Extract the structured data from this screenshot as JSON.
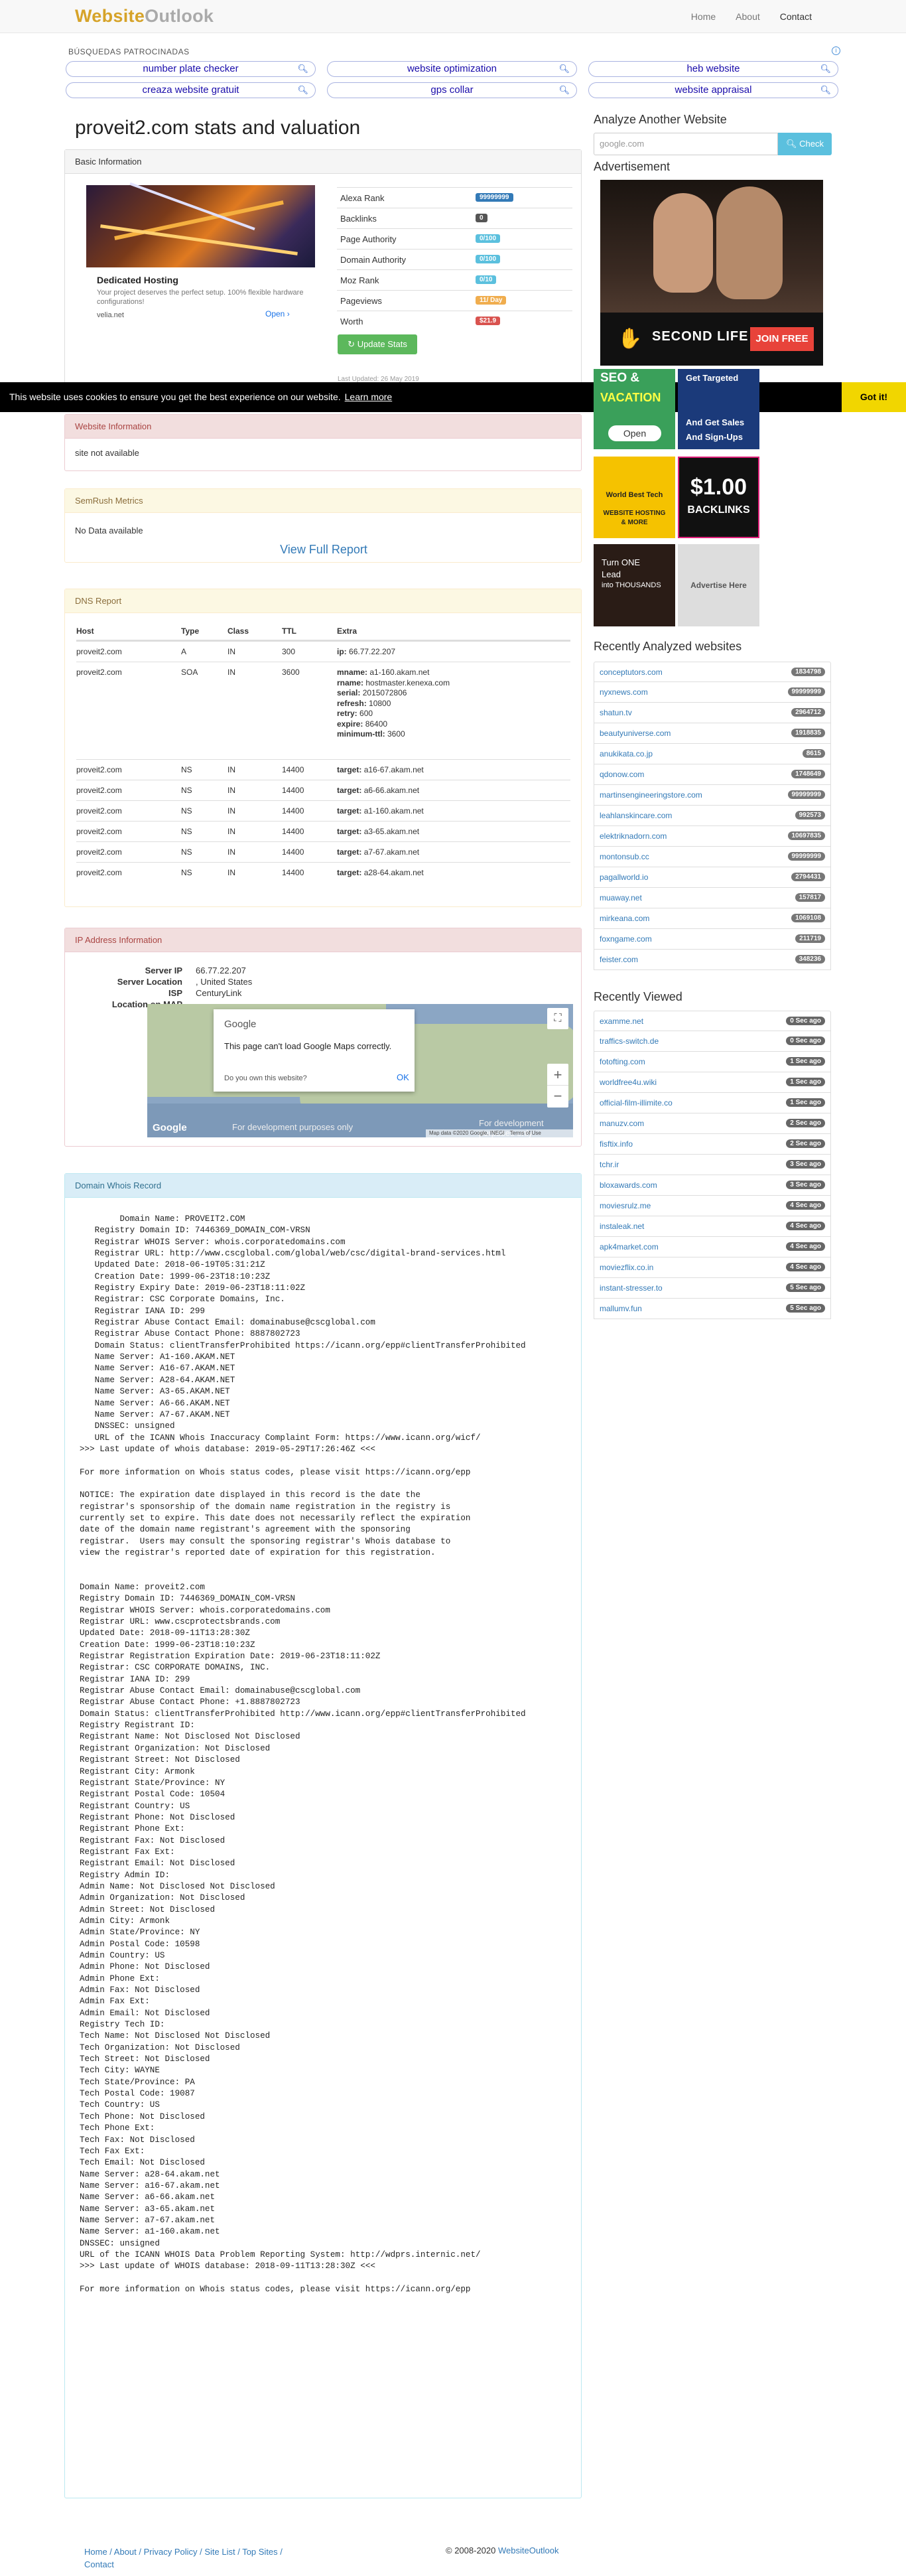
{
  "brand": {
    "part1": "Website",
    "part2": "Outlook"
  },
  "nav": [
    "Home",
    "About",
    "Contact"
  ],
  "ads": {
    "label": "BÚSQUEDAS PATROCINADAS",
    "adchoice": "i",
    "pills": [
      "number plate checker",
      "website optimization",
      "heb website",
      "creaza website gratuit",
      "gps collar",
      "website appraisal"
    ]
  },
  "title": "proveit2.com stats and valuation",
  "basic": {
    "header": "Basic Information",
    "ad": {
      "title": "Dedicated Hosting",
      "desc": "Your project deserves the perfect setup. 100% flexible hardware configurations!",
      "site": "velia.net",
      "open": "Open"
    },
    "metrics": [
      {
        "label": "Alexa Rank",
        "value": "99999999",
        "color": "#337ab7"
      },
      {
        "label": "Backlinks",
        "value": "0",
        "color": "#555"
      },
      {
        "label": "Page Authority",
        "value": "0/100",
        "color": "#5bc0de"
      },
      {
        "label": "Domain Authority",
        "value": "0/100",
        "color": "#5bc0de"
      },
      {
        "label": "Moz Rank",
        "value": "0/10",
        "color": "#5bc0de"
      },
      {
        "label": "Pageviews",
        "value": "11/ Day",
        "color": "#f0ad4e"
      },
      {
        "label": "Worth",
        "value": "$21.9",
        "color": "#d9534f"
      }
    ],
    "update": "Update Stats",
    "last_updated": "Last Updated: 26 May 2019"
  },
  "cookie": {
    "text": "This website uses cookies to ensure you get the best experience on our website.",
    "learn": "Learn more",
    "got": "Got it!"
  },
  "website_info": {
    "header": "Website Information",
    "text": "site not available"
  },
  "semrush": {
    "header": "SemRush Metrics",
    "text": "No Data available",
    "link": "View Full Report"
  },
  "dns": {
    "header": "DNS Report",
    "cols": [
      "Host",
      "Type",
      "Class",
      "TTL",
      "Extra"
    ],
    "rows": [
      {
        "host": "proveit2.com",
        "type": "A",
        "class": "IN",
        "ttl": "300",
        "extra": [
          [
            "ip:",
            "66.77.22.207"
          ]
        ]
      },
      {
        "host": "proveit2.com",
        "type": "SOA",
        "class": "IN",
        "ttl": "3600",
        "extra": [
          [
            "mname:",
            "a1-160.akam.net"
          ],
          [
            "rname:",
            "hostmaster.kenexa.com"
          ],
          [
            "serial:",
            "2015072806"
          ],
          [
            "refresh:",
            "10800"
          ],
          [
            "retry:",
            "600"
          ],
          [
            "expire:",
            "86400"
          ],
          [
            "minimum-ttl:",
            "3600"
          ]
        ]
      },
      {
        "host": "proveit2.com",
        "type": "NS",
        "class": "IN",
        "ttl": "14400",
        "extra": [
          [
            "target:",
            "a16-67.akam.net"
          ]
        ]
      },
      {
        "host": "proveit2.com",
        "type": "NS",
        "class": "IN",
        "ttl": "14400",
        "extra": [
          [
            "target:",
            "a6-66.akam.net"
          ]
        ]
      },
      {
        "host": "proveit2.com",
        "type": "NS",
        "class": "IN",
        "ttl": "14400",
        "extra": [
          [
            "target:",
            "a1-160.akam.net"
          ]
        ]
      },
      {
        "host": "proveit2.com",
        "type": "NS",
        "class": "IN",
        "ttl": "14400",
        "extra": [
          [
            "target:",
            "a3-65.akam.net"
          ]
        ]
      },
      {
        "host": "proveit2.com",
        "type": "NS",
        "class": "IN",
        "ttl": "14400",
        "extra": [
          [
            "target:",
            "a7-67.akam.net"
          ]
        ]
      },
      {
        "host": "proveit2.com",
        "type": "NS",
        "class": "IN",
        "ttl": "14400",
        "extra": [
          [
            "target:",
            "a28-64.akam.net"
          ]
        ]
      }
    ]
  },
  "ip": {
    "header": "IP Address Information",
    "rows": [
      [
        "Server IP",
        "66.77.22.207"
      ],
      [
        "Server Location",
        ", United States"
      ],
      [
        "ISP",
        "CenturyLink"
      ],
      [
        "Location on MAP",
        ""
      ]
    ],
    "map": {
      "google": "Google",
      "msg": "This page can't load Google Maps correctly.",
      "own": "Do you own this website?",
      "ok": "OK",
      "dev1": "For development purposes only",
      "dev2": "For development purposes only",
      "attrib": "Map data ©2020 Google, INEGI",
      "terms": "Terms of Use",
      "logo": "Google"
    }
  },
  "whois": {
    "header": "Domain Whois Record",
    "text": "        Domain Name: PROVEIT2.COM\n   Registry Domain ID: 7446369_DOMAIN_COM-VRSN\n   Registrar WHOIS Server: whois.corporatedomains.com\n   Registrar URL: http://www.cscglobal.com/global/web/csc/digital-brand-services.html\n   Updated Date: 2018-06-19T05:31:21Z\n   Creation Date: 1999-06-23T18:10:23Z\n   Registry Expiry Date: 2019-06-23T18:11:02Z\n   Registrar: CSC Corporate Domains, Inc.\n   Registrar IANA ID: 299\n   Registrar Abuse Contact Email: domainabuse@cscglobal.com\n   Registrar Abuse Contact Phone: 8887802723\n   Domain Status: clientTransferProhibited https://icann.org/epp#clientTransferProhibited\n   Name Server: A1-160.AKAM.NET\n   Name Server: A16-67.AKAM.NET\n   Name Server: A28-64.AKAM.NET\n   Name Server: A3-65.AKAM.NET\n   Name Server: A6-66.AKAM.NET\n   Name Server: A7-67.AKAM.NET\n   DNSSEC: unsigned\n   URL of the ICANN Whois Inaccuracy Complaint Form: https://www.icann.org/wicf/\n>>> Last update of whois database: 2019-05-29T17:26:46Z <<<\n\nFor more information on Whois status codes, please visit https://icann.org/epp\n\nNOTICE: The expiration date displayed in this record is the date the\nregistrar's sponsorship of the domain name registration in the registry is\ncurrently set to expire. This date does not necessarily reflect the expiration\ndate of the domain name registrant's agreement with the sponsoring\nregistrar.  Users may consult the sponsoring registrar's Whois database to\nview the registrar's reported date of expiration for this registration.\n\n\nDomain Name: proveit2.com\nRegistry Domain ID: 7446369_DOMAIN_COM-VRSN\nRegistrar WHOIS Server: whois.corporatedomains.com\nRegistrar URL: www.cscprotectsbrands.com\nUpdated Date: 2018-09-11T13:28:30Z\nCreation Date: 1999-06-23T18:10:23Z\nRegistrar Registration Expiration Date: 2019-06-23T18:11:02Z\nRegistrar: CSC CORPORATE DOMAINS, INC.\nRegistrar IANA ID: 299\nRegistrar Abuse Contact Email: domainabuse@cscglobal.com\nRegistrar Abuse Contact Phone: +1.8887802723\nDomain Status: clientTransferProhibited http://www.icann.org/epp#clientTransferProhibited\nRegistry Registrant ID:\nRegistrant Name: Not Disclosed Not Disclosed\nRegistrant Organization: Not Disclosed\nRegistrant Street: Not Disclosed\nRegistrant City: Armonk\nRegistrant State/Province: NY\nRegistrant Postal Code: 10504\nRegistrant Country: US\nRegistrant Phone: Not Disclosed\nRegistrant Phone Ext:\nRegistrant Fax: Not Disclosed\nRegistrant Fax Ext:\nRegistrant Email: Not Disclosed\nRegistry Admin ID:\nAdmin Name: Not Disclosed Not Disclosed\nAdmin Organization: Not Disclosed\nAdmin Street: Not Disclosed\nAdmin City: Armonk\nAdmin State/Province: NY\nAdmin Postal Code: 10598\nAdmin Country: US\nAdmin Phone: Not Disclosed\nAdmin Phone Ext:\nAdmin Fax: Not Disclosed\nAdmin Fax Ext:\nAdmin Email: Not Disclosed\nRegistry Tech ID:\nTech Name: Not Disclosed Not Disclosed\nTech Organization: Not Disclosed\nTech Street: Not Disclosed\nTech City: WAYNE\nTech State/Province: PA\nTech Postal Code: 19087\nTech Country: US\nTech Phone: Not Disclosed\nTech Phone Ext:\nTech Fax: Not Disclosed\nTech Fax Ext:\nTech Email: Not Disclosed\nName Server: a28-64.akam.net\nName Server: a16-67.akam.net\nName Server: a6-66.akam.net\nName Server: a3-65.akam.net\nName Server: a7-67.akam.net\nName Server: a1-160.akam.net\nDNSSEC: unsigned\nURL of the ICANN WHOIS Data Problem Reporting System: http://wdprs.internic.net/\n>>> Last update of WHOIS database: 2018-09-11T13:28:30Z <<<\n\nFor more information on Whois status codes, please visit https://icann.org/epp"
  },
  "sidebar": {
    "analyze": "Analyze Another Website",
    "search_placeholder": "google.com",
    "check": "Check",
    "advertisement": "Advertisement",
    "sl": {
      "brand": "SECOND LIFE",
      "join": "JOIN FREE"
    },
    "banners": [
      {
        "t1": "SEO &",
        "t2": "Vacation",
        "t3": "Open",
        "bg": "#3aa05a"
      },
      {
        "t1": "Get Targeted",
        "t2": "And Get Sales",
        "t3": "And Sign-Ups",
        "bg": "#1b3a7a"
      },
      {
        "t1": "World Best Tech",
        "t2": "WEBSITE HOSTING",
        "t3": "& MORE",
        "bg": "#f5c200"
      },
      {
        "t1": "$1.00",
        "t2": "BACKLINKS",
        "t3": "",
        "bg": "#111"
      },
      {
        "t1": "Turn ONE",
        "t2": "Lead",
        "t3": "into THOUSANDS",
        "bg": "#2a1c16"
      },
      {
        "t1": "Advertise Here",
        "t2": "",
        "t3": "",
        "bg": "#ddd"
      }
    ],
    "recent_analyzed_title": "Recently Analyzed websites",
    "recent_analyzed": [
      [
        "conceptutors.com",
        "1834798"
      ],
      [
        "nyxnews.com",
        "99999999"
      ],
      [
        "shatun.tv",
        "2964712"
      ],
      [
        "beautyuniverse.com",
        "1918835"
      ],
      [
        "anukikata.co.jp",
        "8615"
      ],
      [
        "qdonow.com",
        "1748649"
      ],
      [
        "martinsengineeringstore.com",
        "99999999"
      ],
      [
        "leahlanskincare.com",
        "992573"
      ],
      [
        "elektriknadorn.com",
        "10697835"
      ],
      [
        "montonsub.cc",
        "99999999"
      ],
      [
        "pagallworld.io",
        "2794431"
      ],
      [
        "muaway.net",
        "157817"
      ],
      [
        "mirkeana.com",
        "1069108"
      ],
      [
        "foxngame.com",
        "211719"
      ],
      [
        "feister.com",
        "348236"
      ]
    ],
    "recent_viewed_title": "Recently Viewed",
    "recent_viewed": [
      [
        "examme.net",
        "0 Sec ago"
      ],
      [
        "traffics-switch.de",
        "0 Sec ago"
      ],
      [
        "fotofting.com",
        "1 Sec ago"
      ],
      [
        "worldfree4u.wiki",
        "1 Sec ago"
      ],
      [
        "official-film-illimite.co",
        "1 Sec ago"
      ],
      [
        "manuzv.com",
        "2 Sec ago"
      ],
      [
        "fisftix.info",
        "2 Sec ago"
      ],
      [
        "tchr.ir",
        "3 Sec ago"
      ],
      [
        "bloxawards.com",
        "3 Sec ago"
      ],
      [
        "moviesrulz.me",
        "4 Sec ago"
      ],
      [
        "instaleak.net",
        "4 Sec ago"
      ],
      [
        "apk4market.com",
        "4 Sec ago"
      ],
      [
        "moviezflix.co.in",
        "4 Sec ago"
      ],
      [
        "instant-stresser.to",
        "5 Sec ago"
      ],
      [
        "mallumv.fun",
        "5 Sec ago"
      ]
    ]
  },
  "footer": {
    "links": "Home / About / Privacy Policy / Site List / Top Sites / Contact",
    "copy": "© 2008-2020 ",
    "copy_link": "WebsiteOutlook"
  }
}
